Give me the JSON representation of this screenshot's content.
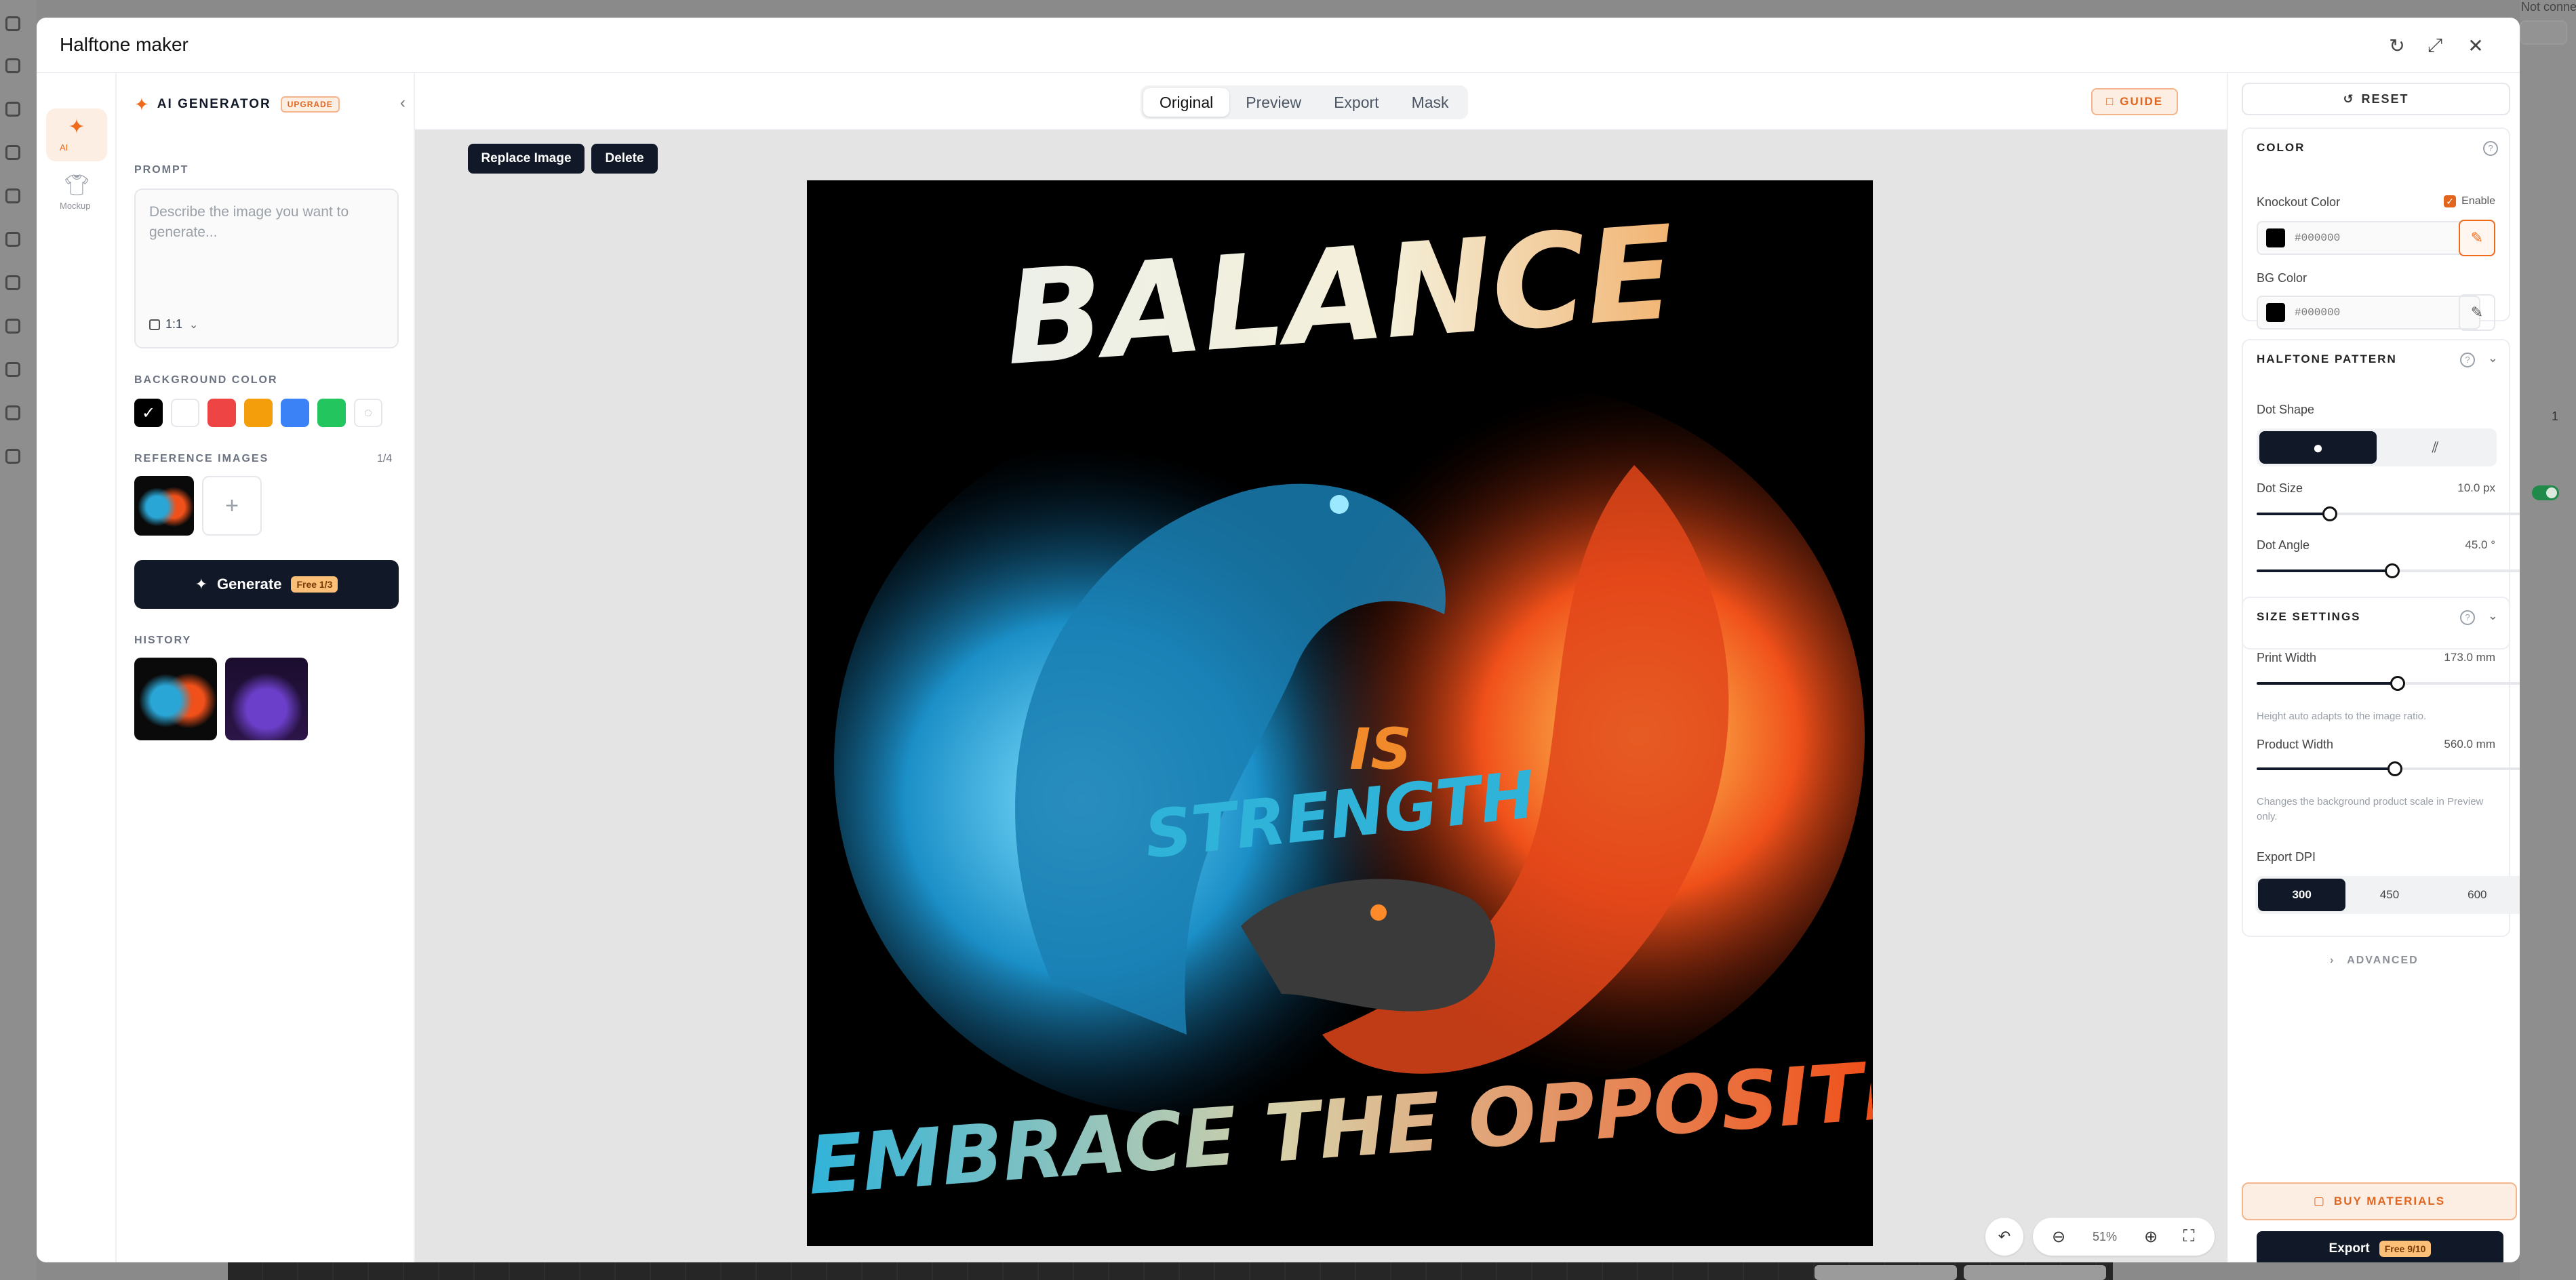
{
  "backdrop": {
    "top_right_text": "Not connected"
  },
  "window": {
    "title": "Halftone maker"
  },
  "rail": {
    "items": [
      {
        "label": "AI",
        "icon": "sparkle-icon"
      },
      {
        "label": "Mockup",
        "icon": "shirt-icon"
      }
    ]
  },
  "left_panel": {
    "title": "AI GENERATOR",
    "upgrade_badge": "UPGRADE",
    "prompt_label": "PROMPT",
    "prompt_placeholder": "Describe the image you want to generate...",
    "prompt_value": "",
    "aspect_ratio": "1:1",
    "bg_color_label": "BACKGROUND COLOR",
    "bg_colors": [
      "#000000",
      "#ffffff",
      "#ef4444",
      "#f59e0b",
      "#3b82f6",
      "#22c55e"
    ],
    "selected_bg_color": "#000000",
    "ref_label": "REFERENCE IMAGES",
    "ref_count": "1/4",
    "generate_label": "Generate",
    "generate_badge": "Free 1/3",
    "history_label": "HISTORY"
  },
  "canvas": {
    "tabs": [
      "Original",
      "Preview",
      "Export",
      "Mask"
    ],
    "active_tab": "Original",
    "guide_label": "GUIDE",
    "replace_label": "Replace Image",
    "delete_label": "Delete",
    "artwork_text": {
      "line1": "BALANCE",
      "line2": "IS",
      "line3": "STRENGTH",
      "line4": "EMBRACE THE OPPOSITES"
    },
    "zoom": "51%"
  },
  "right_panel": {
    "reset_label": "RESET",
    "color": {
      "header": "COLOR",
      "knockout_label": "Knockout Color",
      "enable_label": "Enable",
      "enable_checked": true,
      "knockout_value": "#000000",
      "bg_label": "BG Color",
      "bg_value": "#000000"
    },
    "halftone": {
      "header": "HALFTONE PATTERN",
      "dot_shape_label": "Dot Shape",
      "dot_shape_selected": "circle",
      "dot_size_label": "Dot Size",
      "dot_size_value": "10.0 px",
      "dot_size_fraction": 0.27,
      "dot_angle_label": "Dot Angle",
      "dot_angle_value": "45.0 °",
      "dot_angle_fraction": 0.5
    },
    "size": {
      "header": "SIZE SETTINGS",
      "print_width_label": "Print Width",
      "print_width_value": "173.0 mm",
      "print_width_fraction": 0.52,
      "print_hint": "Height auto adapts to the image ratio.",
      "product_width_label": "Product Width",
      "product_width_value": "560.0 mm",
      "product_width_fraction": 0.51,
      "product_hint": "Changes the background product scale in Preview only.",
      "dpi_label": "Export DPI",
      "dpi_options": [
        "300",
        "450",
        "600"
      ],
      "dpi_selected": "300"
    },
    "advanced_label": "ADVANCED",
    "buy_label": "BUY MATERIALS",
    "export_label": "Export",
    "export_badge": "Free 9/10"
  }
}
